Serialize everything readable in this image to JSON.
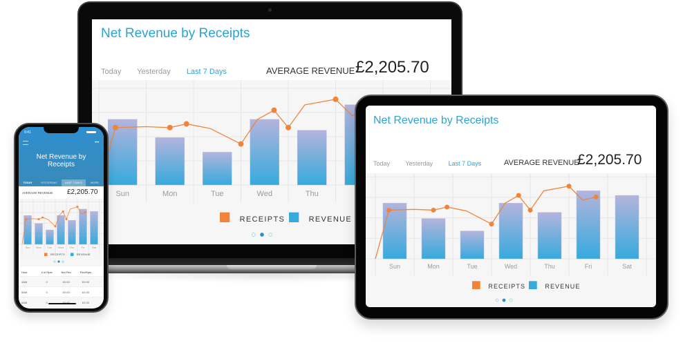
{
  "app": {
    "title": "Net Revenue by Receipts",
    "tabs": [
      {
        "label": "Today",
        "active": false
      },
      {
        "label": "Yesterday",
        "active": false
      },
      {
        "label": "Last 7 Days",
        "active": true
      }
    ],
    "phone_tabs": [
      {
        "label": "TODAY",
        "active": false
      },
      {
        "label": "YESTERDAY",
        "active": false
      },
      {
        "label": "LAST 7 DAYS",
        "active": true
      },
      {
        "label": "MORE",
        "active": false
      }
    ],
    "average_label": "AVERAGE REVENUE",
    "average_value": "£2,205.70",
    "phone_title_line1": "Net Revenue by",
    "phone_title_line2": "Receipts",
    "phone_time": "9:41",
    "pager": {
      "pages": 3,
      "current": 2
    }
  },
  "colors": {
    "accent": "#2aa4d5",
    "receipts": "#f0843a",
    "revenue": "#36aadd",
    "revenue_top": "#b3b4dc",
    "phone_header": "#2f8fc4"
  },
  "table": {
    "headers": [
      "Hour",
      "# of Rpts",
      "Net Rev",
      "Rev/Rpts"
    ],
    "rows": [
      [
        "4AM",
        "0",
        "£0.00",
        "£0.00"
      ],
      [
        "5AM",
        "0",
        "£0.00",
        "£0.00"
      ],
      [
        "6AM",
        "0",
        "£0.00",
        "£0.00"
      ]
    ]
  },
  "chart_data": {
    "type": "bar",
    "title": "Net Revenue by Receipts",
    "categories": [
      "Sun",
      "Mon",
      "Tue",
      "Wed",
      "Thu",
      "Fri",
      "Sat"
    ],
    "series": [
      {
        "name": "REVENUE",
        "type": "bar",
        "values": [
          72,
          52,
          36,
          72,
          60,
          88,
          82
        ]
      },
      {
        "name": "RECEIPTS",
        "type": "line",
        "x": [
          0,
          0.35,
          1,
          1.5,
          1.85,
          2.35,
          3,
          3.35,
          3.7,
          4,
          4.35,
          5,
          5.35,
          5.7
        ],
        "values": [
          0,
          63,
          64,
          63,
          67,
          62,
          45,
          72,
          82,
          63,
          88,
          94,
          76,
          80
        ],
        "markers": [
          1,
          3,
          4,
          6,
          8,
          9,
          11,
          13
        ]
      }
    ],
    "legend": [
      "RECEIPTS",
      "REVENUE"
    ],
    "legend_position": "bottom",
    "ylim": [
      0,
      100
    ],
    "grid": true,
    "xlabel": "",
    "ylabel": ""
  }
}
